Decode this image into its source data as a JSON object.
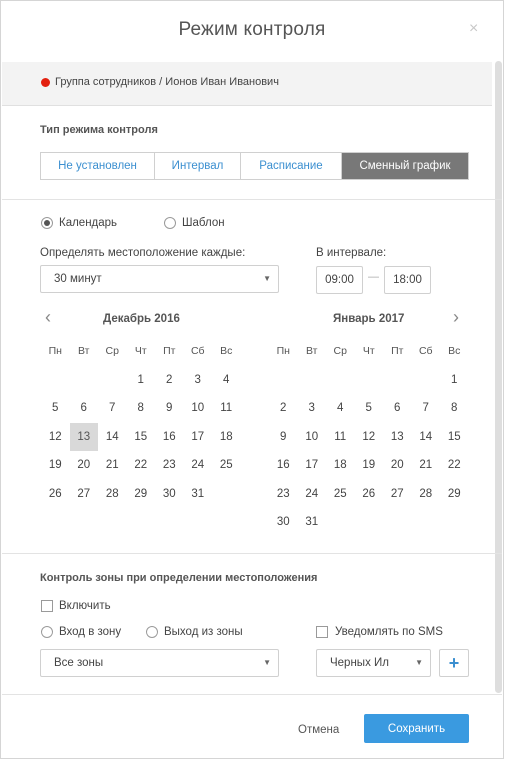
{
  "dialog": {
    "title": "Режим контроля",
    "close_glyph": "×",
    "breadcrumb": "Группа сотрудников / Ионов Иван Иванович",
    "status_color": "#e3200f"
  },
  "mode": {
    "label": "Тип режима контроля",
    "options": [
      "Не установлен",
      "Интервал",
      "Расписание",
      "Сменный график"
    ],
    "active_index": 3
  },
  "source": {
    "options": [
      "Календарь",
      "Шаблон"
    ],
    "selected": "Календарь"
  },
  "location": {
    "label": "Определять местоположение каждые:",
    "value": "30 минут",
    "interval_label": "В интервале:",
    "from": "09:00",
    "to": "18:00"
  },
  "calendar": {
    "weekdays": [
      "Пн",
      "Вт",
      "Ср",
      "Чт",
      "Пт",
      "Сб",
      "Вс"
    ],
    "months": [
      {
        "title": "Декабрь 2016",
        "offset": 3,
        "days": 31,
        "selected": 13
      },
      {
        "title": "Январь 2017",
        "offset": 6,
        "days": 31,
        "selected": null
      }
    ],
    "prev_glyph": "‹",
    "next_glyph": "›"
  },
  "zone": {
    "label": "Контроль зоны при определении местоположения",
    "enable_label": "Включить",
    "enter_label": "Вход в зону",
    "exit_label": "Выход из зоны",
    "sms_label": "Уведомлять по SMS",
    "zones_value": "Все зоны",
    "recipient_value": "Черных Ил",
    "add_glyph": "+"
  },
  "footer": {
    "cancel_label": "Отмена",
    "save_label": "Сохранить",
    "accent": "#3a9ae0"
  }
}
